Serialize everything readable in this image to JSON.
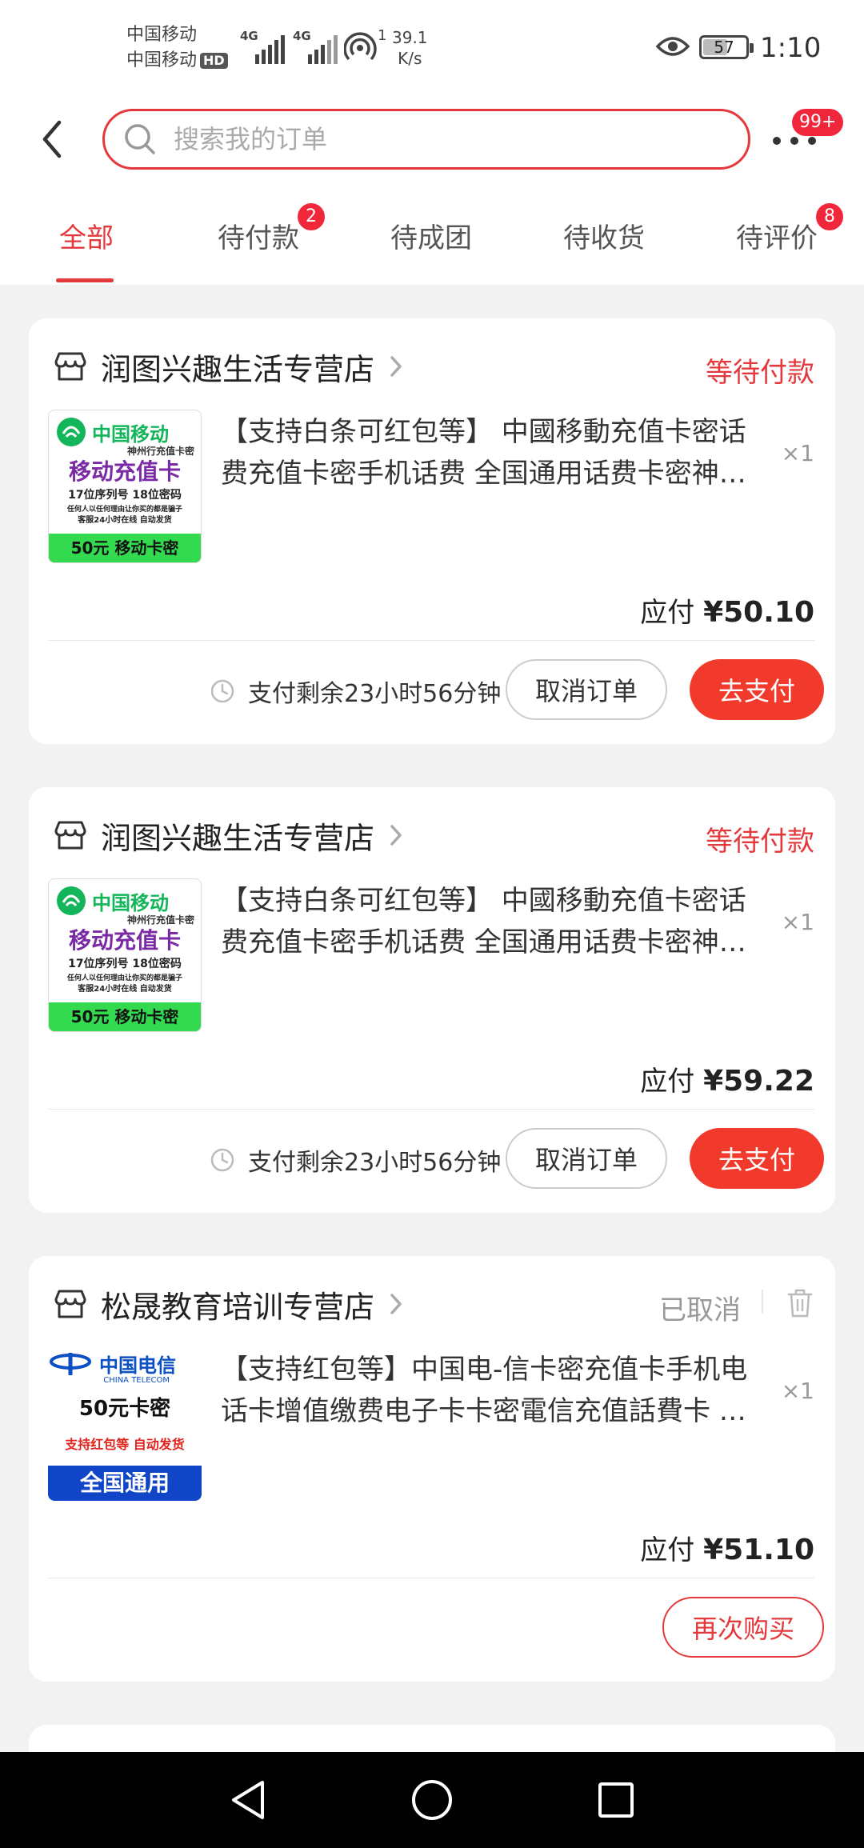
{
  "status_bar": {
    "carrier1": "中国移动",
    "carrier2": "中国移动",
    "hd": "HD",
    "net1": "4G",
    "net2": "4G",
    "hotspot_count": "1",
    "speed_value": "39.1",
    "speed_unit": "K/s",
    "battery": "57",
    "battery_level_percent": 57,
    "time": "1:10"
  },
  "header": {
    "search_placeholder": "搜索我的订单",
    "more_badge": "99+"
  },
  "tabs": [
    {
      "label": "全部",
      "active": true
    },
    {
      "label": "待付款",
      "badge": "2"
    },
    {
      "label": "待成团"
    },
    {
      "label": "待收货"
    },
    {
      "label": "待评价",
      "badge": "8"
    }
  ],
  "orders": [
    {
      "shop": "润图兴趣生活专营店",
      "status": "等待付款",
      "thumb": {
        "brand": "中国移动",
        "sub": "神州行充值卡密",
        "main": "移动充值卡",
        "line1": "17位序列号  18位密码",
        "line2": "任何人以任何理由让你买的都是骗子",
        "line3": "客服24小时在线  自动发货",
        "footer": "50元  移动卡密"
      },
      "title_line1": "【支持白条可红包等】 中國移動充值卡密话",
      "title_line2": "费充值卡密手机话费 全国通用话费卡密神…",
      "qty": "×1",
      "price_label": "应付",
      "price": "¥50.10",
      "countdown": "支付剩余23小时56分钟",
      "cancel_label": "取消订单",
      "pay_label": "去支付"
    },
    {
      "shop": "润图兴趣生活专营店",
      "status": "等待付款",
      "thumb": {
        "brand": "中国移动",
        "sub": "神州行充值卡密",
        "main": "移动充值卡",
        "line1": "17位序列号  18位密码",
        "line2": "任何人以任何理由让你买的都是骗子",
        "line3": "客服24小时在线  自动发货",
        "footer": "50元  移动卡密"
      },
      "title_line1": "【支持白条可红包等】 中國移動充值卡密话",
      "title_line2": "费充值卡密手机话费 全国通用话费卡密神…",
      "qty": "×1",
      "price_label": "应付",
      "price": "¥59.22",
      "countdown": "支付剩余23小时56分钟",
      "cancel_label": "取消订单",
      "pay_label": "去支付"
    },
    {
      "shop": "松晟教育培训专营店",
      "status": "已取消",
      "thumb": {
        "brand": "中国电信",
        "brand_en": "CHINA TELECOM",
        "main": "50元卡密",
        "line1": "支持红包等  自动发货",
        "footer": "全国通用"
      },
      "title_line1": "【支持红包等】中国电-信卡密充值卡手机电",
      "title_line2": "话卡增值缴费电子卡卡密電信充值話費卡 …",
      "qty": "×1",
      "price_label": "应付",
      "price": "¥51.10",
      "rebuy_label": "再次购买"
    }
  ],
  "nav": {
    "back": "back-triangle-icon",
    "home": "home-circle-icon",
    "recents": "recents-square-icon"
  }
}
